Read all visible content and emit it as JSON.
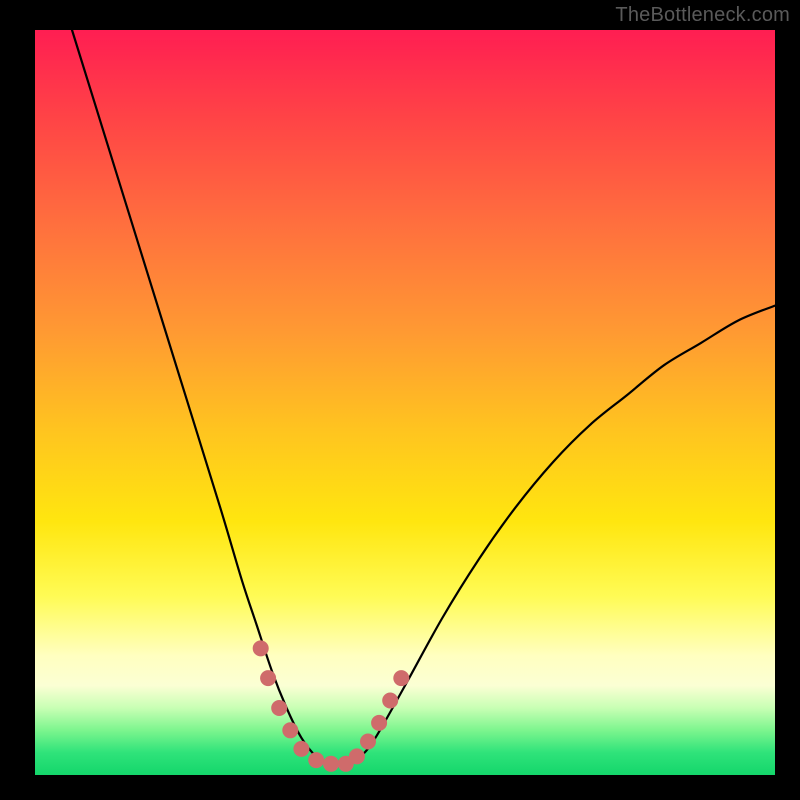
{
  "watermark": "TheBottleneck.com",
  "colors": {
    "background": "#000000",
    "curve": "#000000",
    "marker": "#cf6b6b",
    "gradient_top": "#ff1e52",
    "gradient_bottom": "#14d66b"
  },
  "chart_data": {
    "type": "line",
    "title": "",
    "xlabel": "",
    "ylabel": "",
    "xlim": [
      0,
      100
    ],
    "ylim": [
      0,
      100
    ],
    "grid": false,
    "legend": false,
    "series": [
      {
        "name": "bottleneck-curve",
        "x": [
          5,
          10,
          15,
          20,
          25,
          28,
          30,
          32,
          34,
          36,
          38,
          40,
          42,
          44,
          46,
          50,
          55,
          60,
          65,
          70,
          75,
          80,
          85,
          90,
          95,
          100
        ],
        "values": [
          100,
          84,
          68,
          52,
          36,
          26,
          20,
          14,
          9,
          5,
          2.5,
          1.5,
          1.5,
          2.5,
          5,
          12,
          21,
          29,
          36,
          42,
          47,
          51,
          55,
          58,
          61,
          63
        ]
      }
    ],
    "markers": [
      {
        "x": 30.5,
        "y": 17
      },
      {
        "x": 31.5,
        "y": 13
      },
      {
        "x": 33,
        "y": 9
      },
      {
        "x": 34.5,
        "y": 6
      },
      {
        "x": 36,
        "y": 3.5
      },
      {
        "x": 38,
        "y": 2
      },
      {
        "x": 40,
        "y": 1.5
      },
      {
        "x": 42,
        "y": 1.5
      },
      {
        "x": 43.5,
        "y": 2.5
      },
      {
        "x": 45,
        "y": 4.5
      },
      {
        "x": 46.5,
        "y": 7
      },
      {
        "x": 48,
        "y": 10
      },
      {
        "x": 49.5,
        "y": 13
      }
    ]
  }
}
